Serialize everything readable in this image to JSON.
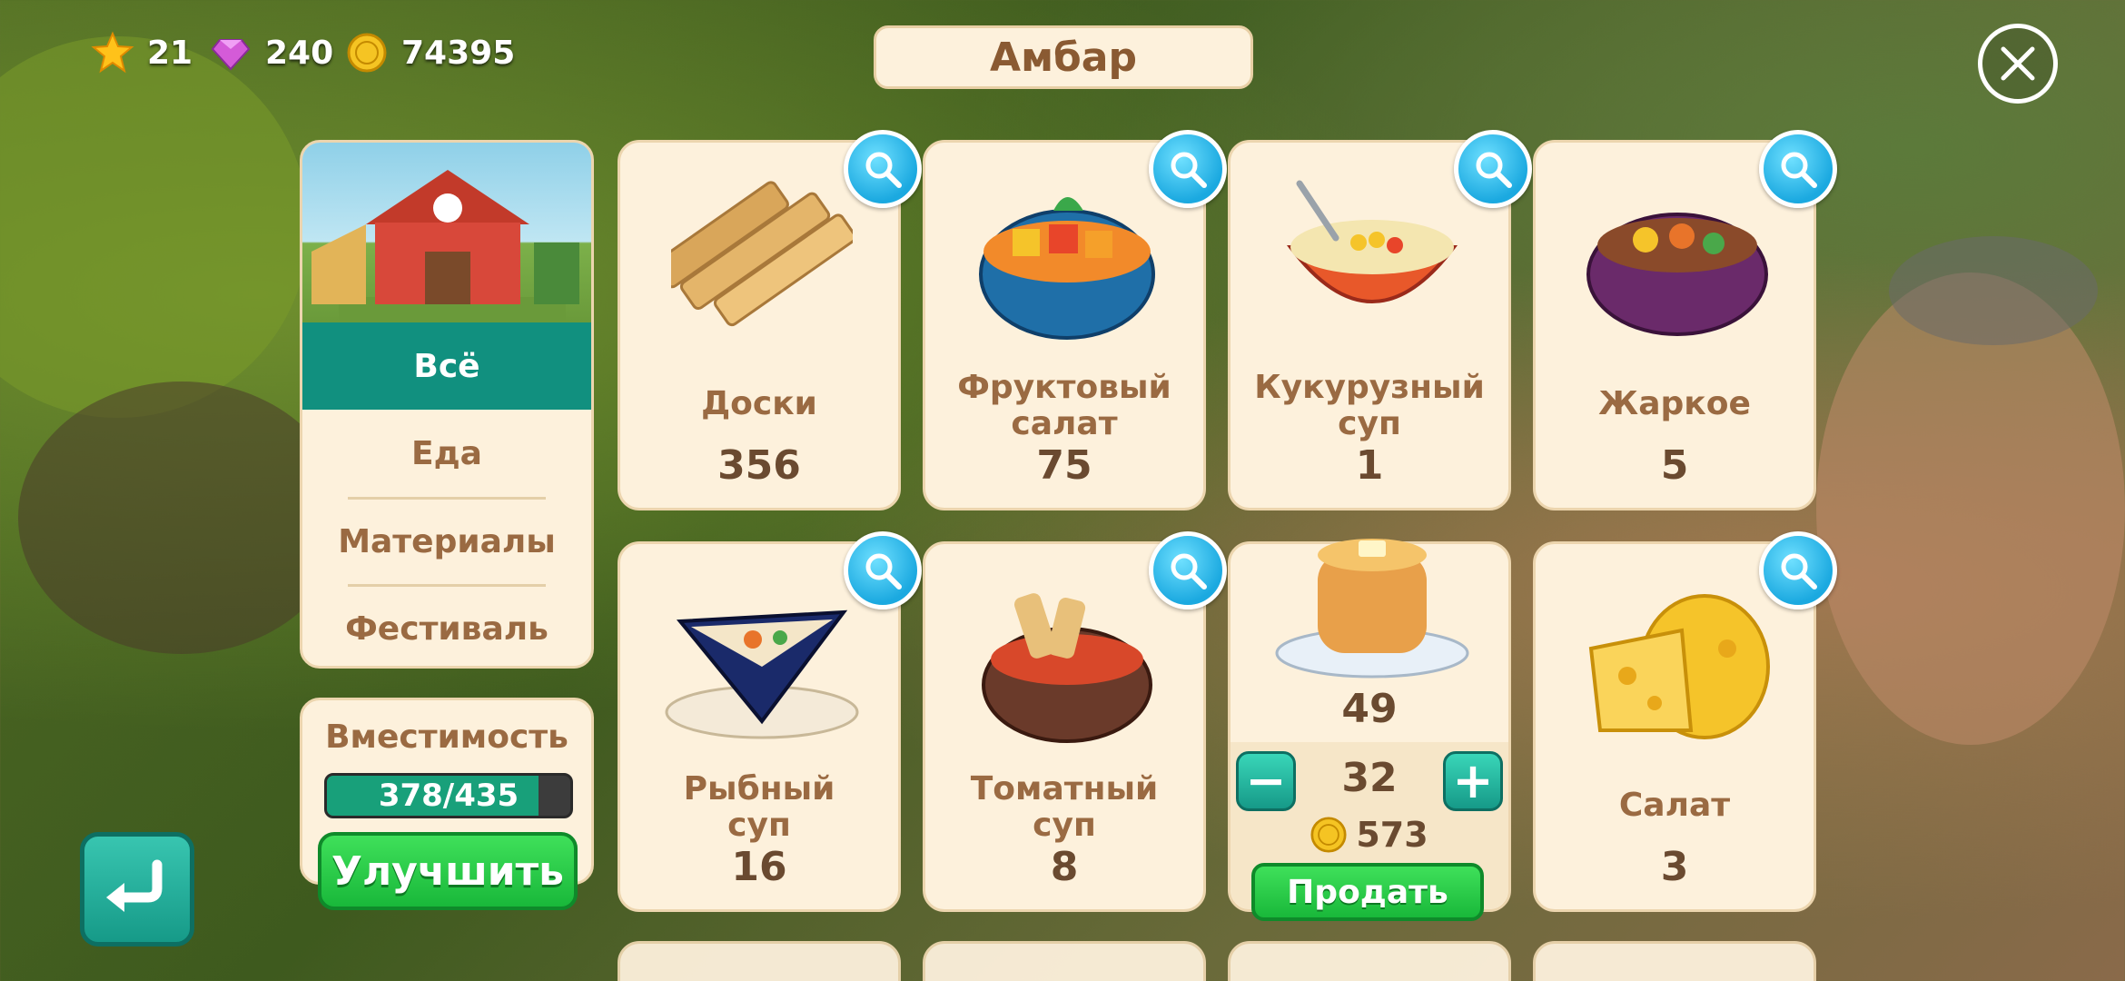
{
  "status": {
    "stars": "21",
    "gems": "240",
    "coins": "74395"
  },
  "title": "Амбар",
  "sidebar": {
    "tabs": [
      {
        "label": "Всё",
        "active": true
      },
      {
        "label": "Еда",
        "active": false
      },
      {
        "label": "Материалы",
        "active": false
      },
      {
        "label": "Фестиваль",
        "active": false
      }
    ]
  },
  "capacity": {
    "label": "Вместимость",
    "value": "378/435",
    "fill_fraction": 0.869
  },
  "buttons": {
    "upgrade": "Улучшить",
    "sell": "Продать"
  },
  "items": [
    {
      "name": "Доски",
      "qty": "356",
      "icon": "planks-icon"
    },
    {
      "name": "Фруктовый\nсалат",
      "qty": "75",
      "icon": "fruit-salad-icon"
    },
    {
      "name": "Кукурузный\nсуп",
      "qty": "1",
      "icon": "corn-soup-icon"
    },
    {
      "name": "Жаркое",
      "qty": "5",
      "icon": "stew-icon"
    },
    {
      "name": "Рыбный\nсуп",
      "qty": "16",
      "icon": "fish-soup-icon"
    },
    {
      "name": "Томатный\nсуп",
      "qty": "8",
      "icon": "tomato-soup-icon"
    },
    {
      "name": "",
      "qty": "49",
      "icon": "pancakes-icon"
    },
    {
      "name": "Салат",
      "qty": "3",
      "icon": "cheese-icon"
    }
  ],
  "sell_panel": {
    "count": "32",
    "price": "573",
    "minus": "−",
    "plus": "+"
  },
  "colors": {
    "accent_teal": "#11907f",
    "button_green": "#19b83a",
    "panel_cream": "#fdf1dc",
    "text_brown": "#9a6a42"
  }
}
